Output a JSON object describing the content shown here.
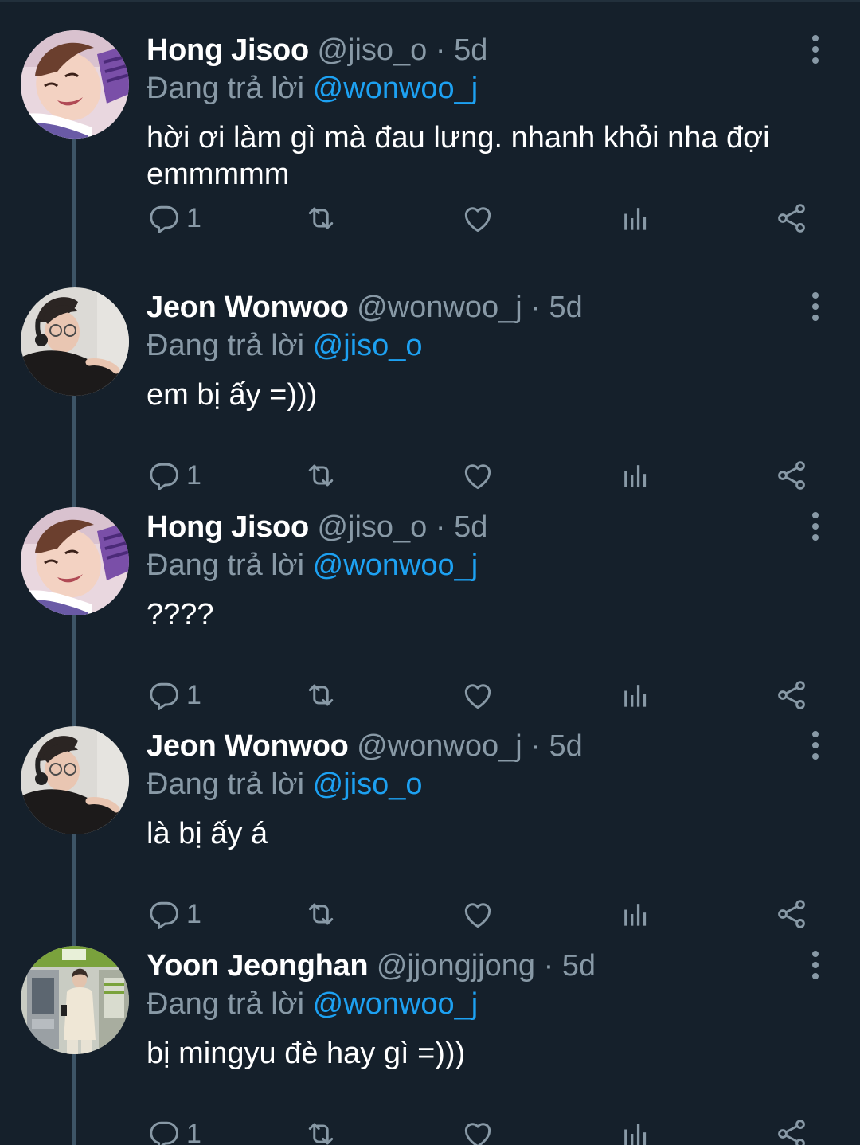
{
  "labels": {
    "replying_prefix": "Đang trả lời",
    "dot": "·"
  },
  "colors": {
    "background": "#15202b",
    "primary_text": "#ffffff",
    "secondary_text": "#8899a6",
    "mention": "#1da1f2",
    "thread_line": "#3d5466"
  },
  "icons": {
    "reply": "speech-bubble-icon",
    "retweet": "retweet-arrows-icon",
    "like": "heart-icon",
    "analytics": "bar-chart-icon",
    "share": "share-icon",
    "more": "vertical-dots-icon"
  },
  "tweets": [
    {
      "name": "Hong Jisoo",
      "handle": "@jiso_o",
      "time": "5d",
      "replying_to": "@wonwoo_j",
      "text": "hời ơi làm gì mà đau lưng. nhanh khỏi nha đợi emmmmm",
      "reply_count": "1",
      "avatar": "jisoo"
    },
    {
      "name": "Jeon Wonwoo",
      "handle": "@wonwoo_j",
      "time": "5d",
      "replying_to": "@jiso_o",
      "text": "em bị ấy =)))",
      "reply_count": "1",
      "avatar": "wonwoo"
    },
    {
      "name": "Hong Jisoo",
      "handle": "@jiso_o",
      "time": "5d",
      "replying_to": "@wonwoo_j",
      "text": "????",
      "reply_count": "1",
      "avatar": "jisoo"
    },
    {
      "name": "Jeon Wonwoo",
      "handle": "@wonwoo_j",
      "time": "5d",
      "replying_to": "@jiso_o",
      "text": "là bị ấy á",
      "reply_count": "1",
      "avatar": "wonwoo"
    },
    {
      "name": "Yoon Jeonghan",
      "handle": "@jjongjjong",
      "time": "5d",
      "replying_to": "@wonwoo_j",
      "text": "bị mingyu đè hay gì =)))",
      "reply_count": "1",
      "avatar": "jeonghan"
    }
  ]
}
